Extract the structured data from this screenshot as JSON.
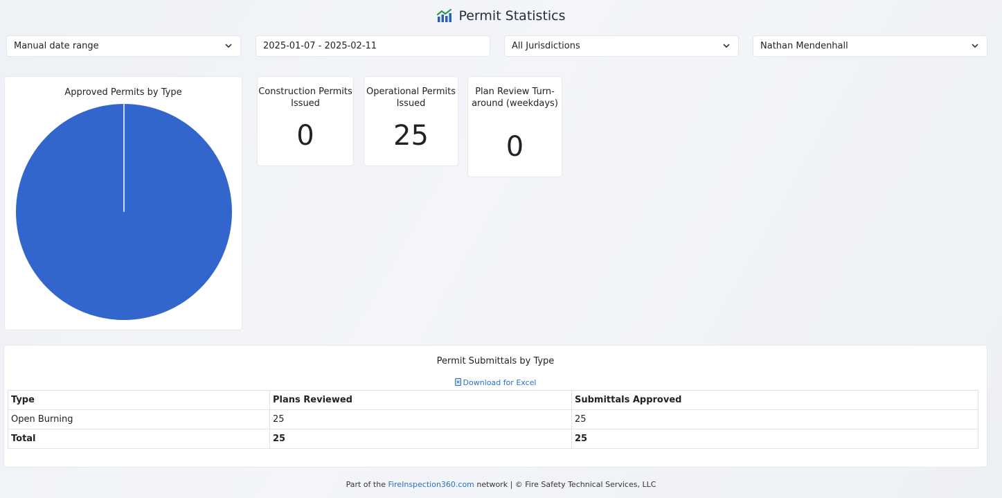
{
  "header": {
    "title": "Permit Statistics",
    "icon": "bar-chart-icon",
    "icon_colors": [
      "#2e9b4f",
      "#2a5fb8"
    ]
  },
  "filters": {
    "date_mode": "Manual date range",
    "date_range": "2025-01-07 - 2025-02-11",
    "jurisdiction": "All Jurisdictions",
    "user": "Nathan Mendenhall"
  },
  "pie": {
    "title": "Approved Permits by Type"
  },
  "chart_data": {
    "type": "pie",
    "title": "Approved Permits by Type",
    "categories": [
      "Open Burning"
    ],
    "values": [
      25
    ],
    "colors": [
      "#3366cc"
    ]
  },
  "stats": {
    "construction_label": "Construction Permits Issued",
    "construction_value": "0",
    "operational_label": "Operational Permits Issued",
    "operational_value": "25",
    "review_label": "Plan Review Turn-around (weekdays)",
    "review_value": "0"
  },
  "table": {
    "title": "Permit Submittals by Type",
    "download_label": "Download for Excel",
    "headers": [
      "Type",
      "Plans Reviewed",
      "Submittals Approved"
    ],
    "rows": [
      [
        "Open Burning",
        "25",
        "25"
      ]
    ],
    "total": [
      "Total",
      "25",
      "25"
    ]
  },
  "footer": {
    "prefix": "Part of the ",
    "link": "FireInspection360.com",
    "suffix": " network | © Fire Safety Technical Services, LLC"
  },
  "colors": {
    "accent_link": "#2a70c8",
    "pie_fill": "#3366cc"
  }
}
